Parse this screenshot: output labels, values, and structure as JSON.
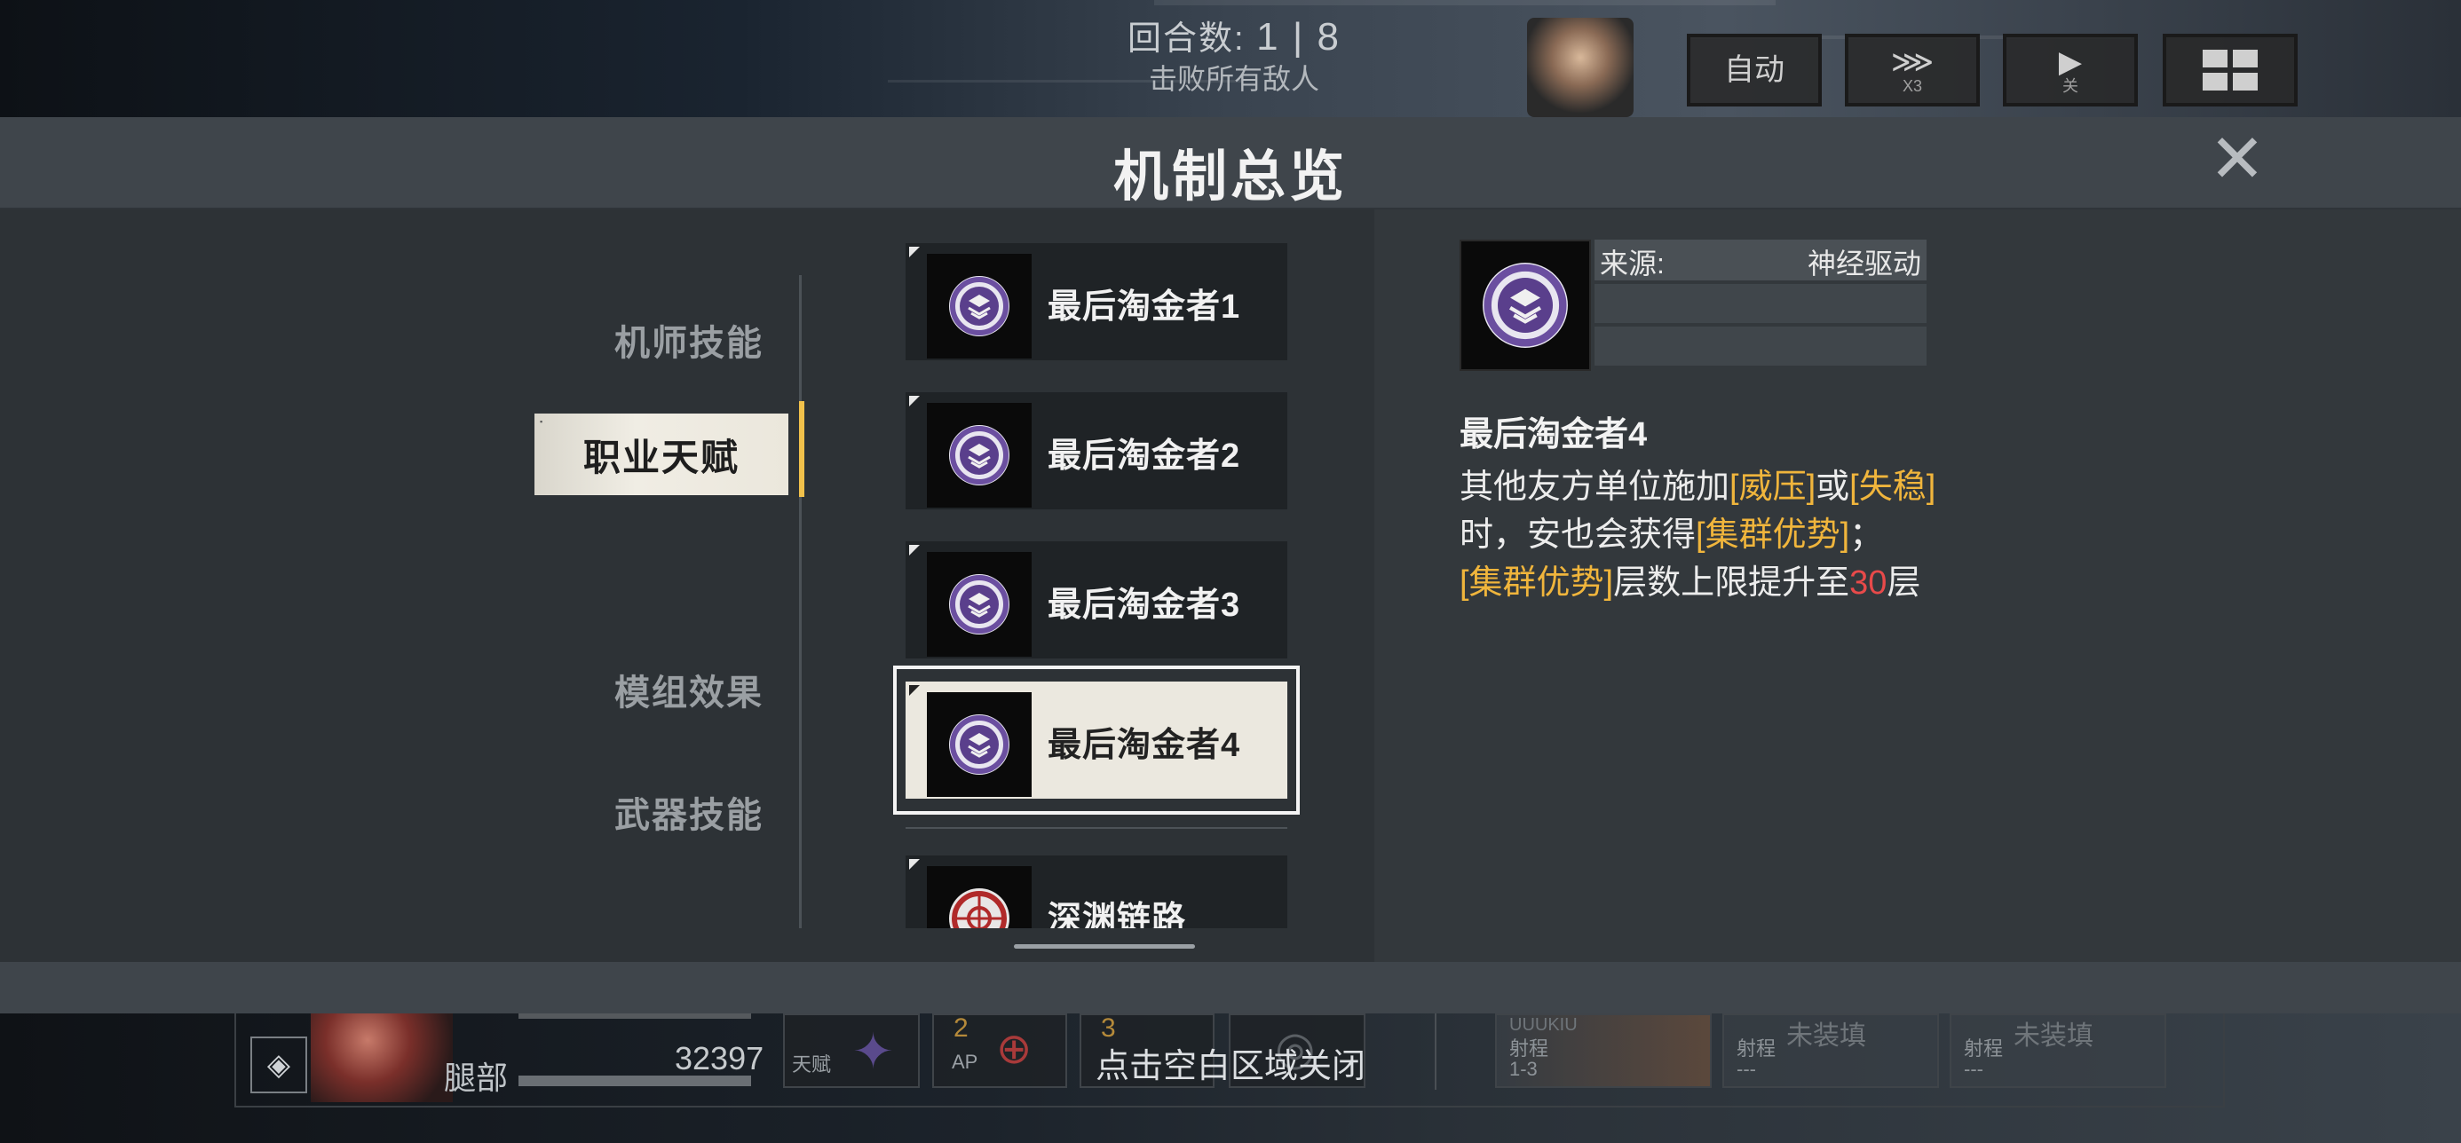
{
  "hud": {
    "round_label": "回合数:",
    "round_value": "1 | 8",
    "objective": "击败所有敌人",
    "buttons": [
      {
        "main": "自动",
        "sub": ""
      },
      {
        "main": "⋙",
        "sub": "X3"
      },
      {
        "main": "▶",
        "sub": "关"
      },
      {
        "main": "",
        "sub": ""
      }
    ]
  },
  "modal": {
    "title": "机制总览",
    "close_icon": "close-icon",
    "footer_hint": "点击空白区域关闭"
  },
  "categories": [
    {
      "label": "机师技能",
      "active": false
    },
    {
      "label": "职业天赋",
      "active": true
    },
    {
      "label": "模组效果",
      "active": false
    },
    {
      "label": "武器技能",
      "active": false
    }
  ],
  "mechanics": [
    {
      "label": "最后淘金者1",
      "icon": "purple-crest-icon",
      "selected": false
    },
    {
      "label": "最后淘金者2",
      "icon": "purple-crest-icon",
      "selected": false
    },
    {
      "label": "最后淘金者3",
      "icon": "purple-crest-icon",
      "selected": false
    },
    {
      "label": "最后淘金者4",
      "icon": "purple-crest-icon",
      "selected": true
    },
    {
      "label": "深渊链路",
      "icon": "red-target-icon",
      "selected": false
    }
  ],
  "detail": {
    "source_label": "来源:",
    "source_value": "神经驱动",
    "name": "最后淘金者4",
    "desc": {
      "p1": "其他友方单位施加",
      "h1": "[威压]",
      "p2": "或",
      "h2": "[失稳]",
      "p3": "时，安也会获得",
      "h3": "[集群优势]",
      "p4": "；",
      "h4": "[集群优势]",
      "p5": "层数上限提升至",
      "n1": "30",
      "p6": "层"
    }
  },
  "bottom_hud": {
    "part_label": "腿部",
    "hp_value": "32397",
    "skill1_label": "天赋",
    "skill2_ap": "2",
    "skill2_label": "AP",
    "skill3_ap": "3",
    "weapon1_label": "射程",
    "weapon1_value": "1-3",
    "weapon1_name": "UUUKIU",
    "weapon2_label": "射程",
    "weapon2_value": "---",
    "weapon2_name": "未装填",
    "weapon3_label": "射程",
    "weapon3_value": "---",
    "weapon3_name": "未装填"
  },
  "colors": {
    "accent_yellow": "#f1c14b",
    "highlight_orange": "#f0b53c",
    "number_red": "#e84a4a",
    "crest_purple": "#6b4fa0"
  }
}
